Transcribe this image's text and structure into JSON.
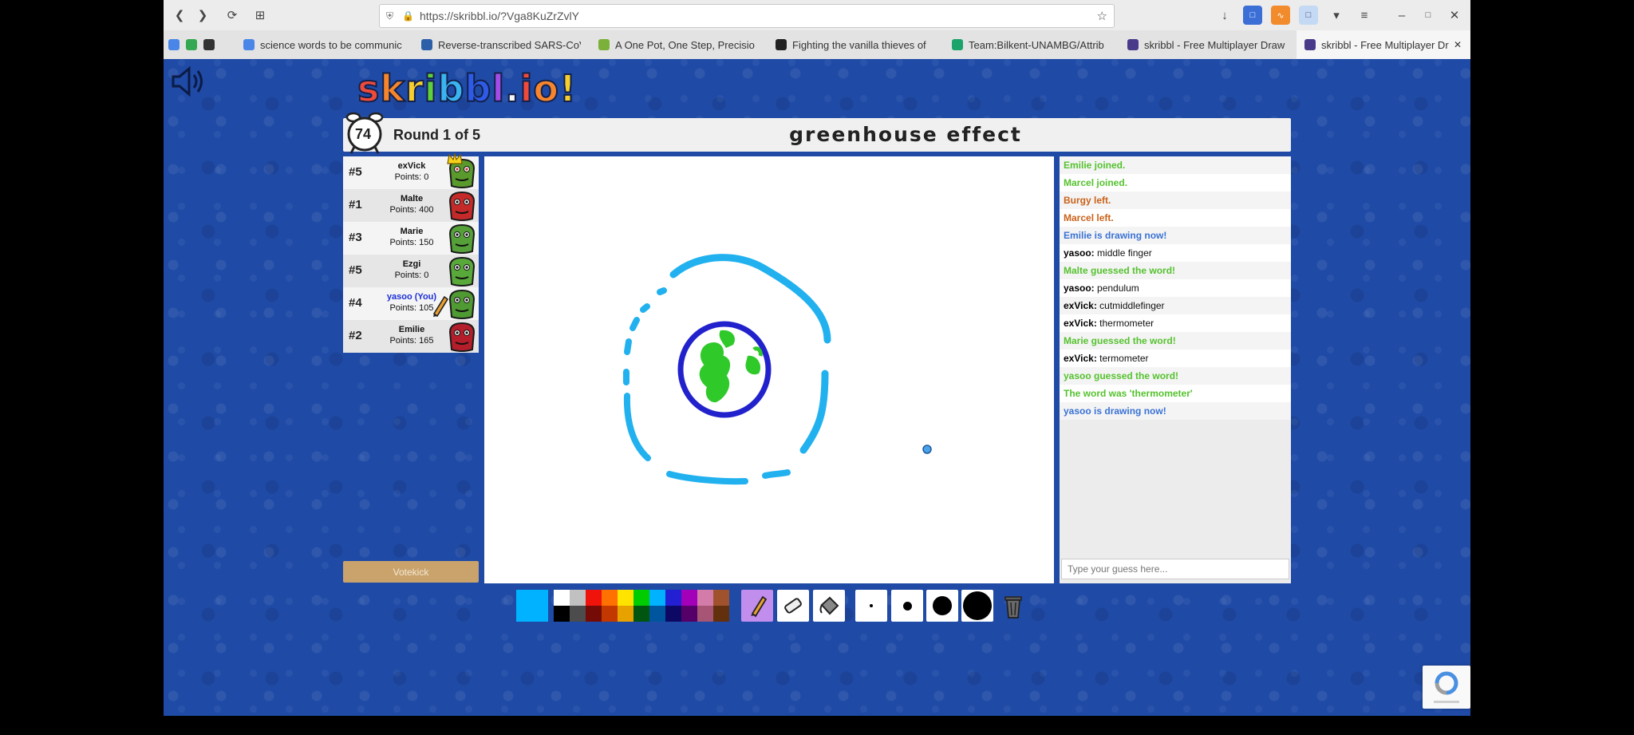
{
  "browser": {
    "url": "https://skribbl.io/?Vga8KuZrZvlY",
    "tabs": [
      {
        "label": "science words to be communic",
        "color": "#4a86e8"
      },
      {
        "label": "Reverse-transcribed SARS-CoV",
        "color": "#2b5fa8"
      },
      {
        "label": "A One Pot, One Step, Precisio",
        "color": "#7bb03a"
      },
      {
        "label": "Fighting the vanilla thieves of",
        "color": "#222222"
      },
      {
        "label": "Team:Bilkent-UNAMBG/Attrib",
        "color": "#1aa36a"
      },
      {
        "label": "skribbl - Free Multiplayer Draw",
        "color": "#4a3a8a"
      },
      {
        "label": "skribbl - Free Multiplayer Dr",
        "color": "#4a3a8a"
      }
    ]
  },
  "logo": {
    "letters": [
      "s",
      "k",
      "r",
      "i",
      "b",
      "b",
      "l",
      ".",
      "i",
      "o",
      "!"
    ],
    "colors": [
      "#ef4a3a",
      "#f7852b",
      "#f6cf2d",
      "#5fcf3a",
      "#39b4f0",
      "#2e5be6",
      "#a54be8",
      "#f7f7f7",
      "#ef4a3a",
      "#f7852b",
      "#f6cf2d"
    ]
  },
  "header": {
    "timer": "74",
    "round": "Round 1 of 5",
    "word": "greenhouse effect"
  },
  "players": [
    {
      "rank": "#5",
      "name": "exVick",
      "points": "Points: 0",
      "avatar_color": "#5a9a2c",
      "eye": "#c33",
      "crown": true,
      "you": false,
      "drawing": false
    },
    {
      "rank": "#1",
      "name": "Malte",
      "points": "Points: 400",
      "avatar_color": "#c42a2a",
      "eye": "#111",
      "crown": false,
      "you": false,
      "drawing": false
    },
    {
      "rank": "#3",
      "name": "Marie",
      "points": "Points: 150",
      "avatar_color": "#55a038",
      "eye": "#111",
      "crown": false,
      "you": false,
      "drawing": false
    },
    {
      "rank": "#5",
      "name": "Ezgi",
      "points": "Points: 0",
      "avatar_color": "#58a83a",
      "eye": "#111",
      "crown": false,
      "you": false,
      "drawing": false
    },
    {
      "rank": "#4",
      "name": "yasoo (You)",
      "points": "Points: 105",
      "avatar_color": "#4f9a32",
      "eye": "#111",
      "crown": false,
      "you": true,
      "drawing": true
    },
    {
      "rank": "#2",
      "name": "Emilie",
      "points": "Points: 165",
      "avatar_color": "#b31e2a",
      "eye": "#111",
      "crown": false,
      "you": false,
      "drawing": false
    }
  ],
  "votekick": "Votekick",
  "chat": [
    {
      "user": "",
      "text": "Emilie joined.",
      "style": "c-green"
    },
    {
      "user": "",
      "text": "Marcel joined.",
      "style": "c-green"
    },
    {
      "user": "",
      "text": "Burgy left.",
      "style": "c-orange"
    },
    {
      "user": "",
      "text": "Marcel left.",
      "style": "c-orange"
    },
    {
      "user": "",
      "text": "Emilie is drawing now!",
      "style": "c-blue"
    },
    {
      "user": "yasoo:",
      "text": "middle finger",
      "style": "c-black"
    },
    {
      "user": "",
      "text": "Malte guessed the word!",
      "style": "c-green"
    },
    {
      "user": "yasoo:",
      "text": "pendulum",
      "style": "c-black"
    },
    {
      "user": "exVick:",
      "text": "cutmiddlefinger",
      "style": "c-black"
    },
    {
      "user": "exVick:",
      "text": "thermometer",
      "style": "c-black"
    },
    {
      "user": "",
      "text": "Marie guessed the word!",
      "style": "c-green"
    },
    {
      "user": "exVick:",
      "text": "termometer",
      "style": "c-black"
    },
    {
      "user": "",
      "text": "yasoo guessed the word!",
      "style": "c-green"
    },
    {
      "user": "",
      "text": "The word was 'thermometer'",
      "style": "c-green"
    },
    {
      "user": "",
      "text": "yasoo is drawing now!",
      "style": "c-blue"
    }
  ],
  "guess": {
    "placeholder": "Type your guess here..."
  },
  "colors": {
    "current": "#00b2ff",
    "palette_top": [
      "#ffffff",
      "#c1c1c1",
      "#ef130b",
      "#ff7100",
      "#ffe400",
      "#00cc00",
      "#00b2ff",
      "#231fd3",
      "#a300ba",
      "#d37caa",
      "#a0522d"
    ],
    "palette_bottom": [
      "#000000",
      "#4c4c4c",
      "#740b07",
      "#c23800",
      "#e8a200",
      "#005510",
      "#00569e",
      "#0e0865",
      "#550069",
      "#a75574",
      "#63300d"
    ]
  }
}
